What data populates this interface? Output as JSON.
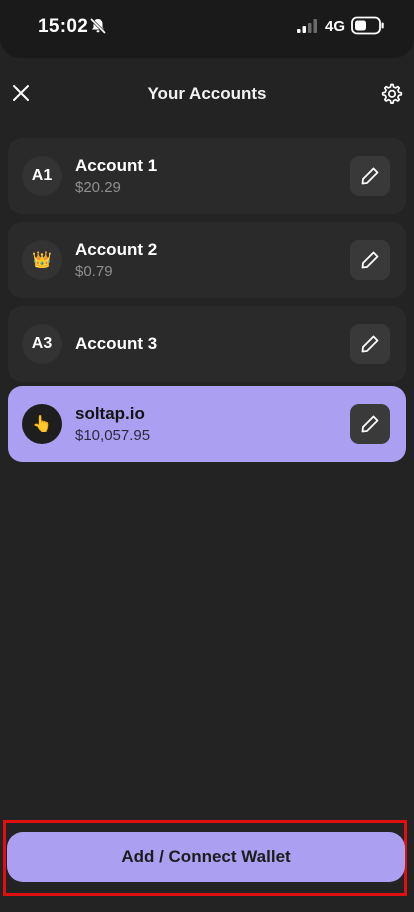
{
  "status_bar": {
    "time": "15:02",
    "network": "4G",
    "icons": [
      "bell-slash-icon",
      "signal-icon",
      "battery-icon"
    ]
  },
  "header": {
    "title": "Your Accounts",
    "left_icon": "close-icon",
    "right_icon": "gear-icon"
  },
  "accounts": [
    {
      "avatar": "A1",
      "name": "Account 1",
      "balance": "$20.29",
      "active": false
    },
    {
      "avatar": "👑",
      "name": "Account 2",
      "balance": "$0.79",
      "active": false
    },
    {
      "avatar": "A3",
      "name": "Account 3",
      "balance": "",
      "active": false
    },
    {
      "avatar": "👆",
      "name": "soltap.io",
      "balance": "$10,057.95",
      "active": true
    }
  ],
  "footer": {
    "add_button_label": "Add / Connect Wallet"
  },
  "colors": {
    "accent": "#ab9ff2",
    "background": "#232323",
    "card": "#2a2a2a",
    "highlight_border": "#e01010"
  }
}
